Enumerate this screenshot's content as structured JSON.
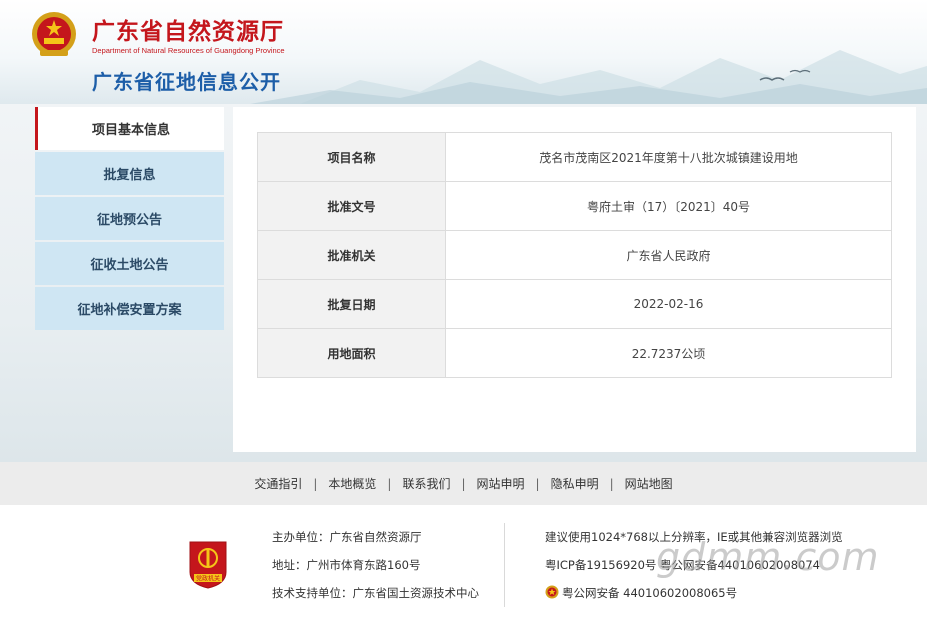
{
  "header": {
    "title": "广东省自然资源厅",
    "subtitle_en": "Department of Natural Resources of Guangdong Province",
    "page_heading": "广东省征地信息公开"
  },
  "sidebar": {
    "items": [
      {
        "label": "项目基本信息"
      },
      {
        "label": "批复信息"
      },
      {
        "label": "征地预公告"
      },
      {
        "label": "征收土地公告"
      },
      {
        "label": "征地补偿安置方案"
      }
    ]
  },
  "info_table": {
    "rows": [
      {
        "key": "项目名称",
        "value": "茂名市茂南区2021年度第十八批次城镇建设用地"
      },
      {
        "key": "批准文号",
        "value": "粤府土审（17）〔2021〕40号"
      },
      {
        "key": "批准机关",
        "value": "广东省人民政府"
      },
      {
        "key": "批复日期",
        "value": "2022-02-16"
      },
      {
        "key": "用地面积",
        "value": "22.7237公顷"
      }
    ]
  },
  "footer_nav": {
    "links": [
      "交通指引",
      "本地概览",
      "联系我们",
      "网站申明",
      "隐私申明",
      "网站地图"
    ],
    "separator": "|"
  },
  "footer": {
    "sponsor": "主办单位：广东省自然资源厅",
    "address": "地址：广州市体育东路160号",
    "tech_support": "技术支持单位：广东省国土资源技术中心",
    "browser_note": "建议使用1024*768以上分辨率，IE或其他兼容浏览器浏览",
    "icp": "粤ICP备19156920号  粤公网安备44010602008074",
    "police": "粤公网安备 44010602008065号",
    "badge_text": "党政机关",
    "watermark": "gdmm.com"
  },
  "colors": {
    "brand_red": "#c4161c",
    "heading_blue": "#1d5ea8",
    "sidebar_bg": "#cfe6f3"
  },
  "icons": {
    "emblem": "national-emblem-icon",
    "badge": "party-government-badge-icon",
    "police": "police-badge-icon"
  }
}
